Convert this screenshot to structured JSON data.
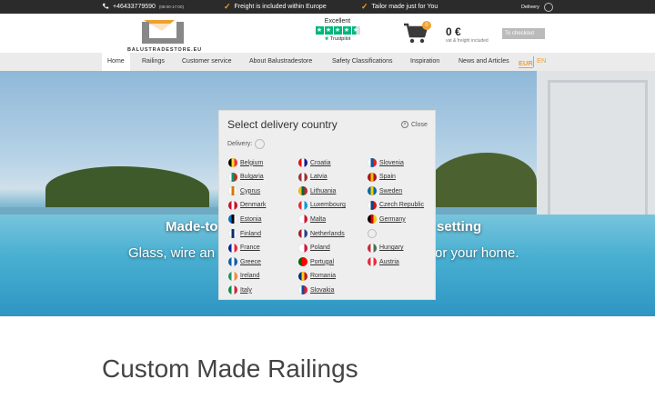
{
  "topbar": {
    "phone": "+46433779590",
    "hours": "(08:00-17:00)",
    "usp1": "Freight is included within Europe",
    "usp2": "Tailor made just for You",
    "delivery": "Delivery"
  },
  "header": {
    "logo_text": "BALUSTRADESTORE.EU",
    "trust_rating": "Excellent",
    "trust_brand": "Trustpilot",
    "cart_count": "0",
    "cart_total": "0 €",
    "vat_note": "vat & freight included",
    "checkout_label": "To checkout"
  },
  "nav": {
    "items": [
      "Home",
      "Railings",
      "Customer service",
      "About Balustradestore",
      "Safety Classifications",
      "Inspiration",
      "News and Articles"
    ],
    "currency": "EUR",
    "language": "EN"
  },
  "hero": {
    "headline_left": "Made-to",
    "headline_right": "setting",
    "sub_left": "Glass, wire an",
    "sub_right": "or your home."
  },
  "modal": {
    "title": "Select delivery country",
    "close_label": "Close",
    "delivery_label": "Delivery:",
    "columns": [
      [
        {
          "name": "Belgium",
          "flag": [
            "#000",
            "#fdda24",
            "#ef3340"
          ]
        },
        {
          "name": "Bulgaria",
          "flag": [
            "#fff",
            "#00966e",
            "#d62612"
          ]
        },
        {
          "name": "Cyprus",
          "flag": [
            "#fff",
            "#d57800",
            "#fff"
          ]
        },
        {
          "name": "Denmark",
          "flag": [
            "#c8102e",
            "#fff",
            "#c8102e"
          ]
        },
        {
          "name": "Estonia",
          "flag": [
            "#0072ce",
            "#000",
            "#fff"
          ]
        },
        {
          "name": "Finland",
          "flag": [
            "#fff",
            "#002f6c",
            "#fff"
          ]
        },
        {
          "name": "France",
          "flag": [
            "#002395",
            "#fff",
            "#ed2939"
          ]
        },
        {
          "name": "Greece",
          "flag": [
            "#0d5eaf",
            "#fff",
            "#0d5eaf"
          ]
        },
        {
          "name": "Ireland",
          "flag": [
            "#169b62",
            "#fff",
            "#ff883e"
          ]
        },
        {
          "name": "Italy",
          "flag": [
            "#009246",
            "#fff",
            "#ce2b37"
          ]
        }
      ],
      [
        {
          "name": "Croatia",
          "flag": [
            "#ff0000",
            "#fff",
            "#171796"
          ]
        },
        {
          "name": "Latvia",
          "flag": [
            "#9e3039",
            "#fff",
            "#9e3039"
          ]
        },
        {
          "name": "Lithuania",
          "flag": [
            "#fdb913",
            "#006a44",
            "#c1272d"
          ]
        },
        {
          "name": "Luxembourg",
          "flag": [
            "#ed2939",
            "#fff",
            "#00a1de"
          ]
        },
        {
          "name": "Malta",
          "flag": [
            "#fff",
            "#fff",
            "#cf142b"
          ]
        },
        {
          "name": "Netherlands",
          "flag": [
            "#ae1c28",
            "#fff",
            "#21468b"
          ]
        },
        {
          "name": "Poland",
          "flag": [
            "#fff",
            "#fff",
            "#dc143c"
          ]
        },
        {
          "name": "Portugal",
          "flag": [
            "#006600",
            "#ff0000",
            "#ff0000"
          ]
        },
        {
          "name": "Romania",
          "flag": [
            "#002b7f",
            "#fcd116",
            "#ce1126"
          ]
        },
        {
          "name": "Slovakia",
          "flag": [
            "#fff",
            "#0b4ea2",
            "#ee1c25"
          ]
        }
      ],
      [
        {
          "name": "Slovenia",
          "flag": [
            "#fff",
            "#005da4",
            "#ed1c24"
          ]
        },
        {
          "name": "Spain",
          "flag": [
            "#aa151b",
            "#f1bf00",
            "#aa151b"
          ]
        },
        {
          "name": "Sweden",
          "flag": [
            "#006aa7",
            "#fecc00",
            "#006aa7"
          ]
        },
        {
          "name": "Czech Republic",
          "flag": [
            "#fff",
            "#11457e",
            "#d7141a"
          ]
        },
        {
          "name": "Germany",
          "flag": [
            "#000",
            "#dd0000",
            "#ffce00"
          ]
        },
        {
          "name": "",
          "flag": null
        },
        {
          "name": "Hungary",
          "flag": [
            "#ce2939",
            "#fff",
            "#477050"
          ]
        },
        {
          "name": "Austria",
          "flag": [
            "#ed2939",
            "#fff",
            "#ed2939"
          ]
        }
      ]
    ]
  },
  "main": {
    "title": "Custom Made Railings"
  },
  "colors": {
    "accent": "#f0a030",
    "topbar": "#2b2b2b",
    "nav": "#ebebeb",
    "trustpilot": "#00b67a"
  }
}
